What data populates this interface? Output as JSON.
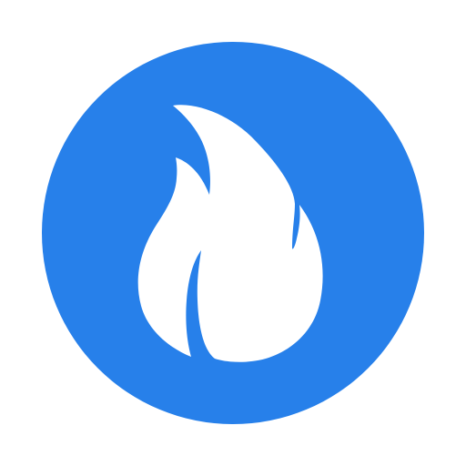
{
  "logo": {
    "icon": "flame-icon",
    "background_color": "#2780EA",
    "flame_color": "#FFFFFF",
    "page_background": "#FFFFFF"
  }
}
